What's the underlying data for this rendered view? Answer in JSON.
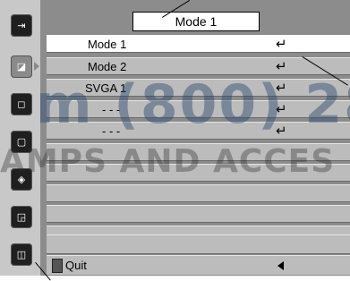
{
  "sidebar": {
    "tabs": [
      {
        "icon": "input-icon",
        "glyph": "⇥"
      },
      {
        "icon": "picture-icon",
        "glyph": "◪"
      },
      {
        "icon": "monitor-icon",
        "glyph": "◻"
      },
      {
        "icon": "screen-icon",
        "glyph": "▢"
      },
      {
        "icon": "setting-icon",
        "glyph": "◈"
      },
      {
        "icon": "language-icon",
        "glyph": "◲"
      },
      {
        "icon": "image-icon",
        "glyph": "◫"
      }
    ]
  },
  "menu": {
    "title": "Mode 1",
    "rows": [
      {
        "label": "Mode 1",
        "enter": "↵",
        "selected": true
      },
      {
        "label": "Mode 2",
        "enter": "↵"
      },
      {
        "label": "SVGA 1",
        "enter": "↵"
      },
      {
        "label": "- - -",
        "enter": "↵"
      },
      {
        "label": "- - -",
        "enter": "↵"
      },
      {
        "label": ""
      },
      {
        "label": ""
      },
      {
        "label": ""
      },
      {
        "label": ""
      },
      {
        "label": ""
      },
      {
        "label": ""
      }
    ],
    "quit": {
      "label": "Quit",
      "icon": "quit-icon"
    }
  },
  "watermark": {
    "line1": "m (800) 28",
    "line2": "AMPS AND ACCES"
  }
}
